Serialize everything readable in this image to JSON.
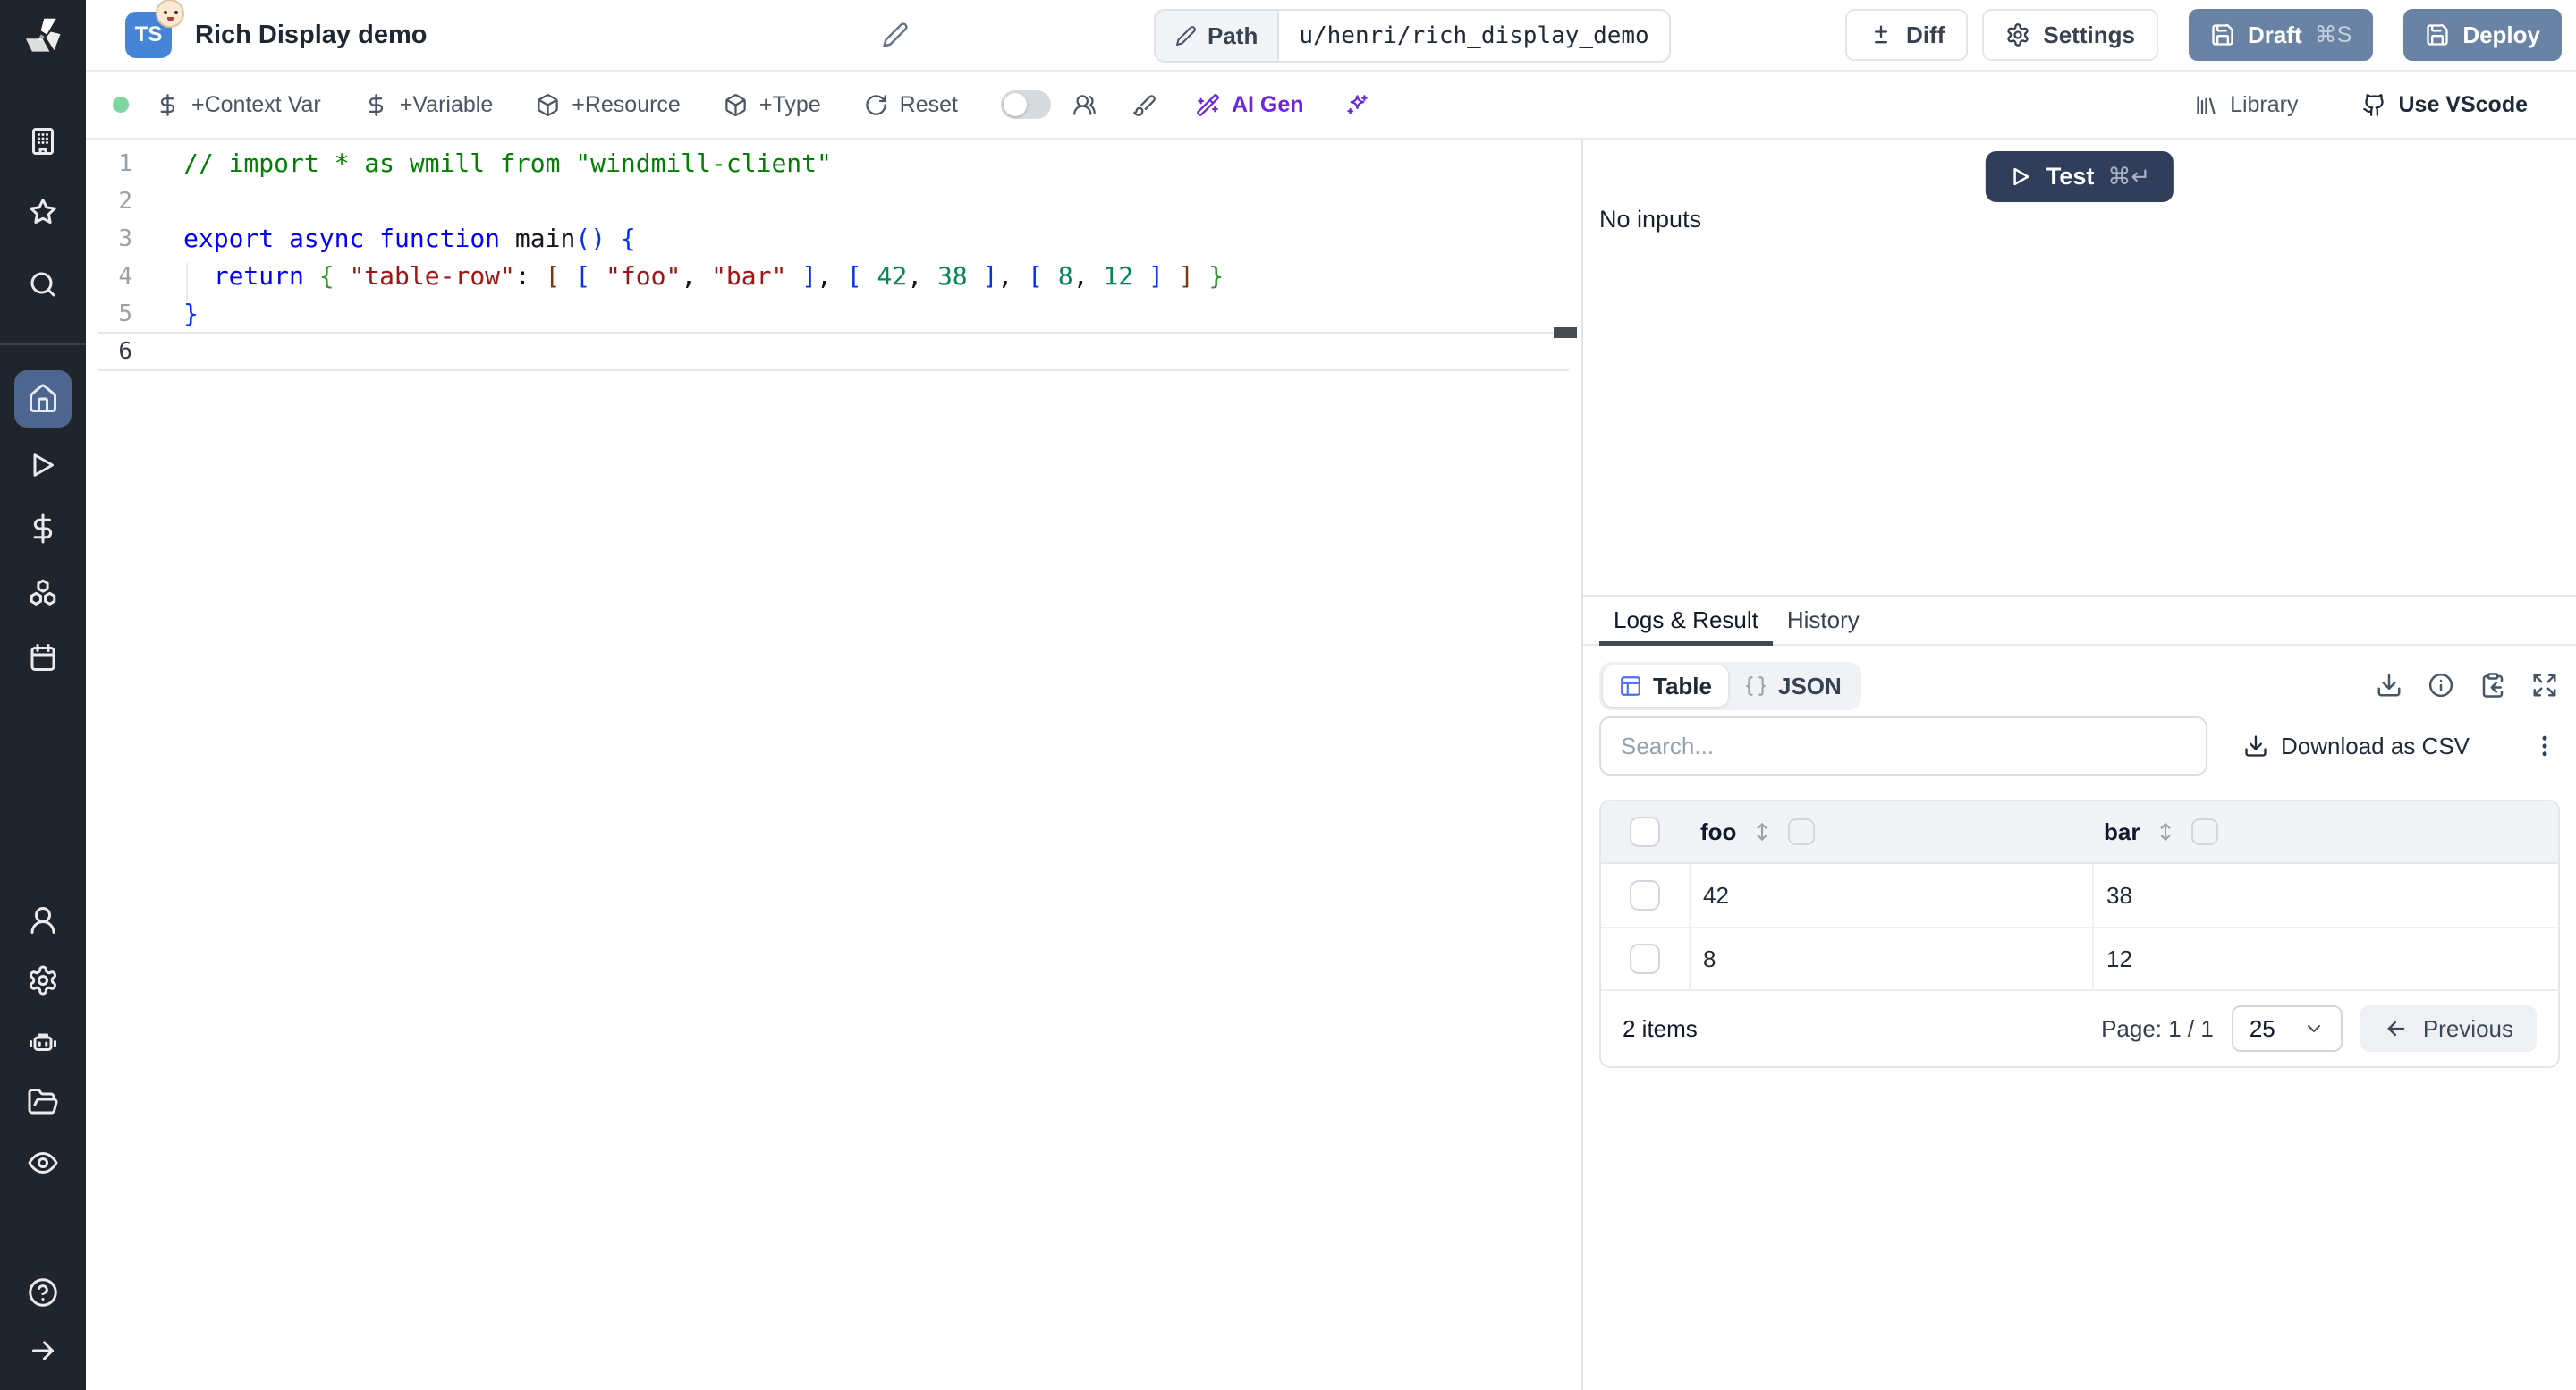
{
  "header": {
    "badge_lang": "TS",
    "badge_emoji": "baby-face-emoji",
    "title": "Rich Display demo",
    "path_label": "Path",
    "path_value": "u/henri/rich_display_demo",
    "diff": "Diff",
    "settings": "Settings",
    "draft": "Draft",
    "draft_shortcut": "⌘S",
    "deploy": "Deploy"
  },
  "toolbar": {
    "context_var": "+Context Var",
    "variable": "+Variable",
    "resource": "+Resource",
    "type": "+Type",
    "reset": "Reset",
    "ai_gen": "AI Gen",
    "library": "Library",
    "use_vscode": "Use VScode"
  },
  "editor": {
    "lines": [
      {
        "num": "1",
        "tokens": [
          {
            "t": "// import * as wmill from \"windmill-client\"",
            "c": "comment"
          }
        ]
      },
      {
        "num": "2",
        "tokens": []
      },
      {
        "num": "3",
        "tokens": [
          {
            "t": "export ",
            "c": "kw"
          },
          {
            "t": "async ",
            "c": "kw"
          },
          {
            "t": "function ",
            "c": "kw"
          },
          {
            "t": "main",
            "c": "fn"
          },
          {
            "t": "(",
            "c": "b1"
          },
          {
            "t": ")",
            "c": "b1"
          },
          {
            "t": " "
          },
          {
            "t": "{",
            "c": "b1"
          }
        ]
      },
      {
        "num": "4",
        "tokens": [
          {
            "t": "  "
          },
          {
            "t": "return",
            "c": "kw"
          },
          {
            "t": " "
          },
          {
            "t": "{",
            "c": "b2"
          },
          {
            "t": " "
          },
          {
            "t": "\"table-row\"",
            "c": "str"
          },
          {
            "t": ": ",
            "c": "plain"
          },
          {
            "t": "[",
            "c": "b3"
          },
          {
            "t": " "
          },
          {
            "t": "[",
            "c": "b1"
          },
          {
            "t": " "
          },
          {
            "t": "\"foo\"",
            "c": "str"
          },
          {
            "t": ", ",
            "c": "plain"
          },
          {
            "t": "\"bar\"",
            "c": "str"
          },
          {
            "t": " "
          },
          {
            "t": "]",
            "c": "b1"
          },
          {
            "t": ", ",
            "c": "plain"
          },
          {
            "t": "[",
            "c": "b1"
          },
          {
            "t": " "
          },
          {
            "t": "42",
            "c": "num"
          },
          {
            "t": ", ",
            "c": "plain"
          },
          {
            "t": "38",
            "c": "num"
          },
          {
            "t": " "
          },
          {
            "t": "]",
            "c": "b1"
          },
          {
            "t": ", ",
            "c": "plain"
          },
          {
            "t": "[",
            "c": "b1"
          },
          {
            "t": " "
          },
          {
            "t": "8",
            "c": "num"
          },
          {
            "t": ", ",
            "c": "plain"
          },
          {
            "t": "12",
            "c": "num"
          },
          {
            "t": " "
          },
          {
            "t": "]",
            "c": "b1"
          },
          {
            "t": " "
          },
          {
            "t": "]",
            "c": "b3"
          },
          {
            "t": " "
          },
          {
            "t": "}",
            "c": "b2"
          }
        ]
      },
      {
        "num": "5",
        "tokens": [
          {
            "t": "}",
            "c": "b1"
          }
        ]
      },
      {
        "num": "6",
        "tokens": [],
        "active": true
      }
    ]
  },
  "run": {
    "test": "Test",
    "shortcut": "⌘↵",
    "no_inputs": "No inputs"
  },
  "result": {
    "tabs": {
      "logs": "Logs & Result",
      "history": "History"
    },
    "views": {
      "table": "Table",
      "json": "JSON"
    },
    "search_placeholder": "Search...",
    "download_csv": "Download as CSV",
    "table": {
      "columns": [
        "foo",
        "bar"
      ],
      "rows": [
        [
          "42",
          "38"
        ],
        [
          "8",
          "12"
        ]
      ]
    },
    "footer": {
      "items": "2 items",
      "page": "Page: 1 / 1",
      "page_size": "25",
      "previous": "Previous"
    }
  },
  "colors": {
    "accent_table_icon": "#4c6ef5",
    "primary_button_slate": "#6a83a5",
    "test_button_navy": "#313e5b",
    "ai_purple": "#6d28d9",
    "status_green": "#7ed6a0",
    "sidebar_bg": "#20242c",
    "sidebar_active": "#4e6590"
  }
}
